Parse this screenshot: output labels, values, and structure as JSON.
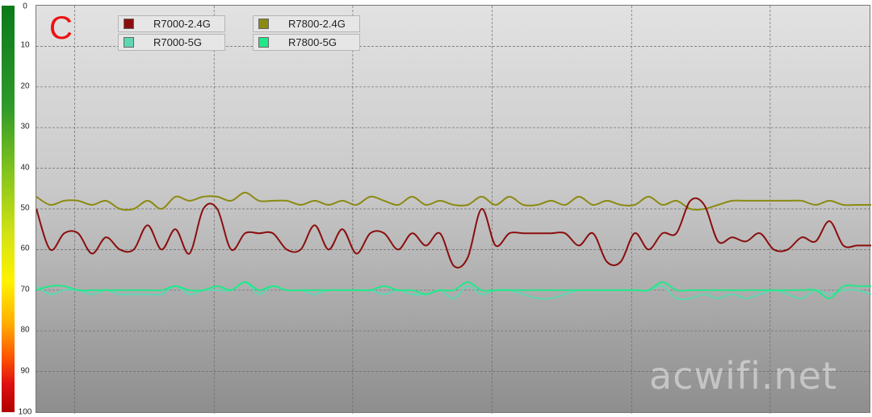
{
  "corner_label": "C",
  "watermark": "acwifi.net",
  "colors": {
    "R7000_2_4G": "#8b0e0e",
    "R7800_2_4G": "#8c8a12",
    "R7000_5G": "#5fd6b2",
    "R7800_5G": "#22e889"
  },
  "chart_data": {
    "type": "line",
    "title": "",
    "xlabel": "",
    "ylabel": "",
    "y_ticks": [
      "0",
      "10",
      "20",
      "30",
      "40",
      "50",
      "60",
      "70",
      "80",
      "90",
      "100"
    ],
    "ylim": [
      0,
      100
    ],
    "y_inverted": true,
    "x_range": [
      0,
      60
    ],
    "grid": true,
    "legend_position": "top-left",
    "series": [
      {
        "name": "R7000-2.4G",
        "color": "#8b0e0e",
        "values": [
          50,
          60,
          56,
          56,
          61,
          57,
          60,
          60,
          54,
          60,
          55,
          61,
          50,
          50,
          60,
          56,
          56,
          56,
          60,
          60,
          54,
          60,
          55,
          61,
          56,
          56,
          60,
          56,
          59,
          56,
          64,
          62,
          50,
          59,
          56,
          56,
          56,
          56,
          56,
          59,
          56,
          63,
          63,
          56,
          60,
          56,
          56,
          48,
          49,
          58,
          57,
          58,
          56,
          60,
          60,
          57,
          58,
          53,
          59,
          59,
          59
        ]
      },
      {
        "name": "R7800-2.4G",
        "color": "#8c8a12",
        "values": [
          47,
          49,
          48,
          48,
          49,
          48,
          50,
          50,
          48,
          50,
          47,
          48,
          47,
          47,
          48,
          46,
          48,
          48,
          48,
          49,
          48,
          49,
          48,
          49,
          47,
          48,
          49,
          47,
          49,
          48,
          49,
          49,
          47,
          49,
          47,
          49,
          49,
          48,
          49,
          47,
          49,
          48,
          49,
          49,
          47,
          49,
          48,
          50,
          50,
          49,
          48,
          48,
          48,
          48,
          48,
          48,
          49,
          48,
          49,
          49,
          49
        ]
      },
      {
        "name": "R7000-5G",
        "color": "#5fd6b2",
        "values": [
          69,
          71,
          70,
          70,
          71,
          70,
          71,
          71,
          71,
          71,
          69,
          71,
          70,
          70,
          70,
          68,
          71,
          69,
          70,
          70,
          71,
          70,
          70,
          70,
          70,
          71,
          70,
          71,
          71,
          70,
          72,
          69,
          71,
          70,
          70,
          71,
          72,
          72,
          71,
          70,
          70,
          70,
          70,
          70,
          70,
          69,
          72,
          72,
          71,
          72,
          71,
          72,
          71,
          70,
          71,
          72,
          70,
          71,
          70,
          70,
          71
        ]
      },
      {
        "name": "R7800-5G",
        "color": "#22e889",
        "values": [
          70,
          69,
          69,
          70,
          70,
          70,
          70,
          70,
          70,
          70,
          69,
          70,
          70,
          69,
          70,
          68,
          70,
          69,
          70,
          70,
          70,
          70,
          70,
          70,
          70,
          69,
          70,
          70,
          71,
          70,
          70,
          68,
          70,
          70,
          70,
          70,
          70,
          70,
          70,
          70,
          70,
          70,
          70,
          70,
          70,
          68,
          70,
          70,
          70,
          70,
          70,
          70,
          70,
          70,
          70,
          70,
          70,
          72,
          69,
          69,
          69
        ]
      }
    ]
  }
}
